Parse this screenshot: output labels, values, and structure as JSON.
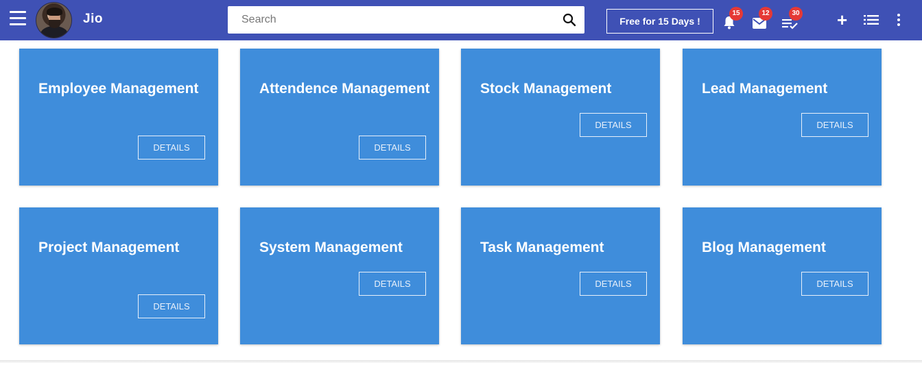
{
  "header": {
    "app_name": "Jio",
    "search_placeholder": "Search",
    "trial_label": "Free for 15 Days !",
    "notifications_count": "15",
    "messages_count": "12",
    "tasks_count": "30",
    "brand_color": "#3f51b5",
    "badge_color": "#e53935",
    "icons": [
      "menu-icon",
      "avatar",
      "search-icon",
      "bell-icon",
      "mail-icon",
      "task-list-icon",
      "plus-icon",
      "list-icon",
      "more-vert-icon"
    ]
  },
  "cards": [
    {
      "title": "Employee Management",
      "button": "DETAILS"
    },
    {
      "title": "Attendence Management",
      "button": "DETAILS"
    },
    {
      "title": "Stock Management",
      "button": "DETAILS"
    },
    {
      "title": "Lead Management",
      "button": "DETAILS"
    },
    {
      "title": "Project Management",
      "button": "DETAILS"
    },
    {
      "title": "System Management",
      "button": "DETAILS"
    },
    {
      "title": "Task Management",
      "button": "DETAILS"
    },
    {
      "title": "Blog Management",
      "button": "DETAILS"
    }
  ],
  "card_color": "#3f8ddb"
}
